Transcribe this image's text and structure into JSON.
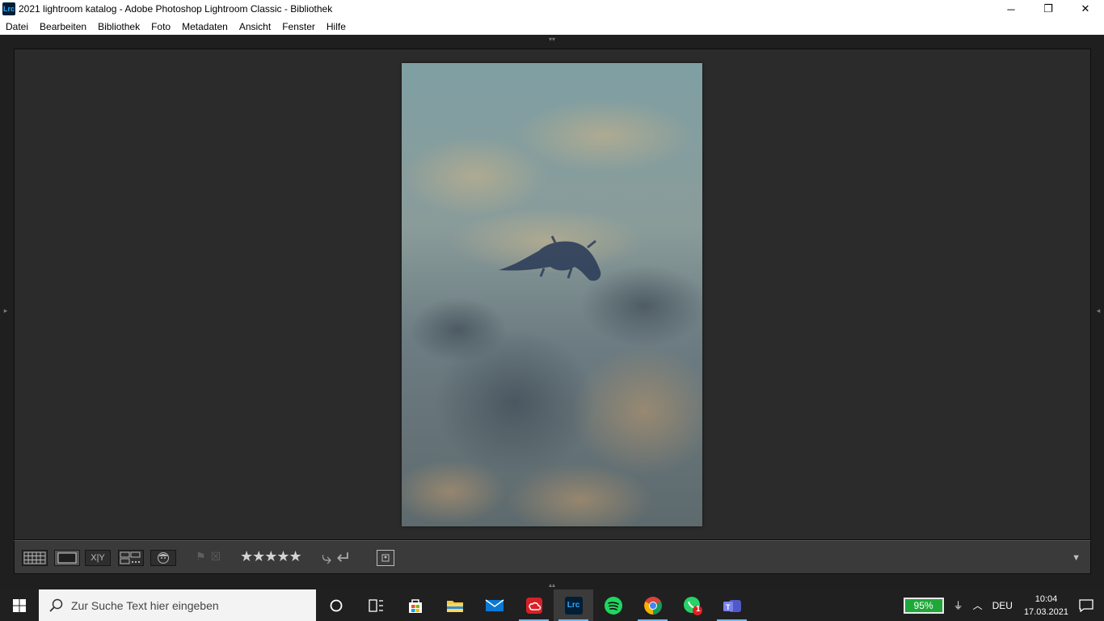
{
  "window": {
    "app_icon_text": "Lrc",
    "title": "2021 lightroom katalog - Adobe Photoshop Lightroom Classic - Bibliothek",
    "minimize": "─",
    "restore": "❐",
    "close": "✕"
  },
  "menu": {
    "items": [
      "Datei",
      "Bearbeiten",
      "Bibliothek",
      "Foto",
      "Metadaten",
      "Ansicht",
      "Fenster",
      "Hilfe"
    ]
  },
  "toolbar": {
    "compare_label": "X|Y",
    "stars": "★★★★★",
    "rotate_left": "⤷",
    "rotate_right": "↵",
    "dropdown": "▼"
  },
  "taskbar": {
    "search_placeholder": "Zur Suche Text hier eingeben",
    "battery": "95%",
    "language": "DEU",
    "time": "10:04",
    "date": "17.03.2021",
    "whatsapp_badge": "1",
    "lrc_label": "Lrc"
  },
  "colors": {
    "workspace_bg": "#1f1f1f",
    "loupe_bg": "#2b2b2b",
    "toolbar_bg": "#3a3a3a",
    "taskbar_bg": "#202020",
    "battery_green": "#1fa83a"
  }
}
